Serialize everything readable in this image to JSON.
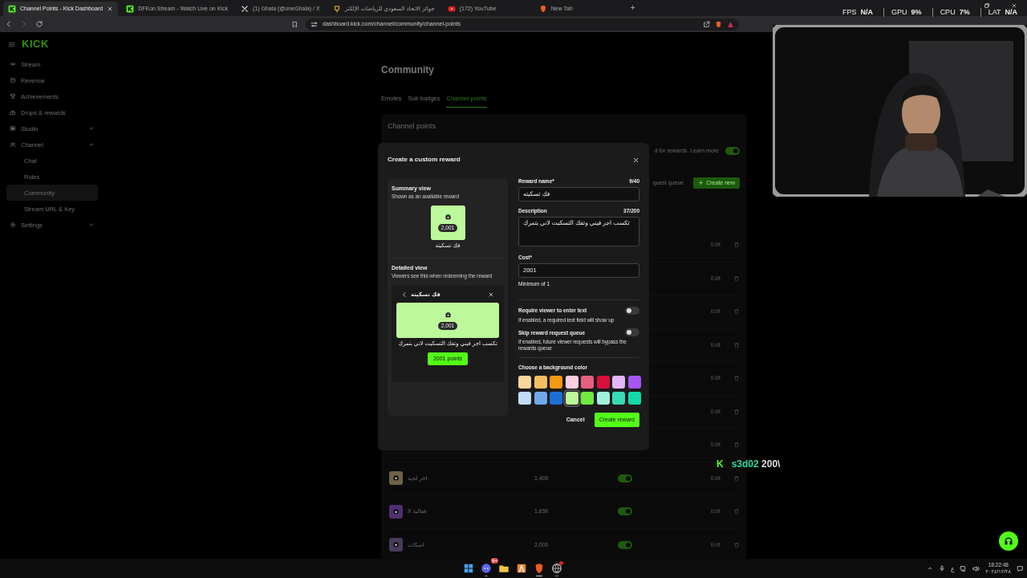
{
  "browser": {
    "tabs": [
      {
        "title": "Channel Points - Kick Dashboard",
        "selected": true
      },
      {
        "title": "DFEon Stream - Watch Live on Kick",
        "selected": false
      },
      {
        "title": "(1) Ghala (@oneGhala) / X",
        "selected": false
      },
      {
        "title": "جوائز الاتحاد السعودي للرياضات الإلكتر",
        "selected": false
      },
      {
        "title": "(172) YouTube",
        "selected": false
      },
      {
        "title": "New Tab",
        "selected": false
      }
    ],
    "new_tab": "+",
    "url": "dashboard.kick.com/channel/community/channel-points"
  },
  "perf": [
    {
      "label": "FPS",
      "value": "N/A"
    },
    {
      "label": "GPU",
      "value": "9%"
    },
    {
      "label": "CPU",
      "value": "7%"
    },
    {
      "label": "LAT",
      "value": "N/A"
    }
  ],
  "sidebar": {
    "logo": "KICK",
    "items": [
      {
        "label": "Stream",
        "selected": false
      },
      {
        "label": "Revenue",
        "selected": false
      },
      {
        "label": "Achievements",
        "selected": false
      },
      {
        "label": "Drops & rewards",
        "selected": false
      },
      {
        "label": "Studio",
        "selected": false,
        "expanded": false
      },
      {
        "label": "Channel",
        "selected": false,
        "expanded": true,
        "children": [
          {
            "label": "Chat",
            "selected": false
          },
          {
            "label": "Roles",
            "selected": false
          },
          {
            "label": "Community",
            "selected": true
          },
          {
            "label": "Stream URL & Key",
            "selected": false
          }
        ]
      },
      {
        "label": "Settings",
        "selected": false,
        "expanded": false
      }
    ]
  },
  "page": {
    "title": "Community",
    "tabs": [
      {
        "label": "Emotes",
        "selected": false
      },
      {
        "label": "Sub badges",
        "selected": false
      },
      {
        "label": "Channel points",
        "selected": true
      }
    ],
    "section_title": "Channel points",
    "info_text": "d for rewards.",
    "learn_more": "Learn more",
    "info_toggle_on": true,
    "queue_text": "quest queue",
    "create_button": "Create new",
    "rewards": [
      {
        "edit": "Edit"
      },
      {
        "edit": "Edit"
      },
      {
        "edit": "Edit"
      },
      {
        "edit": "Edit"
      },
      {
        "edit": "Edit"
      },
      {
        "edit": "Edit"
      },
      {
        "edit": "Edit"
      },
      {
        "name": "اخر لحية",
        "cost": "1,400",
        "enabled": true,
        "color": "#6e6248",
        "edit": "Edit"
      },
      {
        "name": "فعالية X",
        "cost": "1,650",
        "enabled": true,
        "color": "#4f2f72",
        "edit": "Edit"
      },
      {
        "name": "اسكات",
        "cost": "2,000",
        "enabled": true,
        "color": "#4a3a5c",
        "edit": "Edit"
      }
    ]
  },
  "modal": {
    "title": "Create a custom reward",
    "summary_title": "Summary view",
    "summary_subtitle": "Shown as an available reward",
    "summary_badge": "2,001",
    "summary_label": "فك تسكيته",
    "detail_title": "Detailed view",
    "detail_subtitle": "Viewers see this when redeeming the reward",
    "detail_name": "فك تسكيته",
    "detail_badge": "2,001",
    "detail_description": "تكسب اجر فيني وتفك التسكيت لاني بتمرك",
    "redeem_button": "2001 points",
    "fields": [
      {
        "kind": "input",
        "label": "Reward name*",
        "counter": "9/40",
        "value": "فك تسكيته"
      },
      {
        "kind": "textarea",
        "label": "Description",
        "counter": "37/200",
        "value": "تكسب اجر فيني وتفك التسكيت لاني بتمرك"
      },
      {
        "kind": "input",
        "label": "Cost*",
        "value": "2001",
        "hint": "Minimum of 1"
      }
    ],
    "toggles": [
      {
        "label": "Require viewer to enter text",
        "help": "If enabled, a required text field will show up",
        "on": false
      },
      {
        "label": "Skip reward request queue",
        "help": "If enabled, future viewer requests will bypass the rewards queue",
        "on": false
      }
    ],
    "color_label": "Choose a background color",
    "colors": [
      {
        "color": "#fcd59c",
        "selected": false
      },
      {
        "color": "#f6be62",
        "selected": false
      },
      {
        "color": "#f59812",
        "selected": false
      },
      {
        "color": "#fbcfe0",
        "selected": false
      },
      {
        "color": "#e5607f",
        "selected": false
      },
      {
        "color": "#d60f3b",
        "selected": false
      },
      {
        "color": "#e2b6f6",
        "selected": false
      },
      {
        "color": "#a756f5",
        "selected": false
      },
      {
        "color": "#c0dbf8",
        "selected": false
      },
      {
        "color": "#70a8ea",
        "selected": false
      },
      {
        "color": "#1d6fd8",
        "selected": false
      },
      {
        "color": "#bcf99b",
        "selected": true
      },
      {
        "color": "#6fea40",
        "selected": false
      },
      {
        "color": "#a2f1dd",
        "selected": false
      },
      {
        "color": "#38d9b5",
        "selected": false
      },
      {
        "color": "#12dba9",
        "selected": false
      }
    ],
    "cancel": "Cancel",
    "submit": "Create reward"
  },
  "chat_overlay": {
    "logo": "K",
    "user": "s3d02",
    "message": "200\\"
  },
  "taskbar": {
    "apps": [
      {
        "running": false,
        "active": false
      },
      {
        "running": true,
        "active": false,
        "badge": "9+"
      },
      {
        "running": false,
        "active": false
      },
      {
        "running": false,
        "active": false
      },
      {
        "running": true,
        "active": true
      },
      {
        "running": true,
        "active": false,
        "alert": true
      }
    ],
    "language": "ع",
    "time": "18:22:48",
    "date": "٢٠٢٤/١٢/٢٨"
  }
}
